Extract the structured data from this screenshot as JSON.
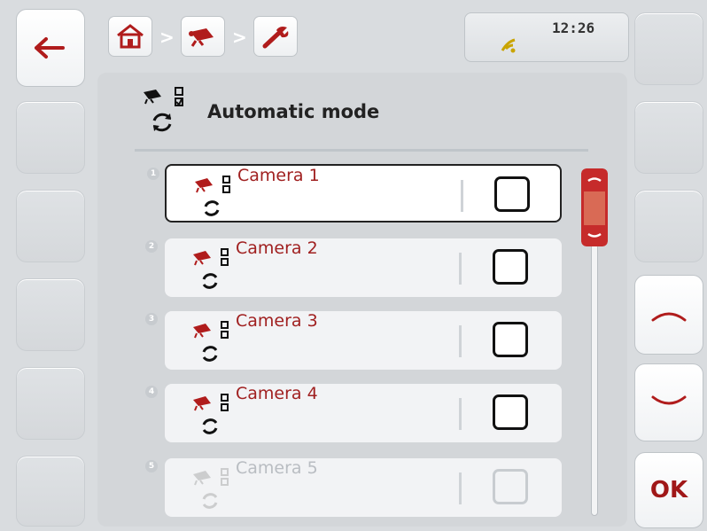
{
  "header": {
    "time": "12:26",
    "breadcrumb_icons": [
      "home-icon",
      "camera-icon",
      "wrench-icon"
    ],
    "breadcrumb_separator": ">",
    "status_icon": "connection-icon"
  },
  "page": {
    "title": "Automatic mode",
    "title_icon": "camera-auto-icon"
  },
  "list": {
    "items": [
      {
        "index": "1",
        "label": "Camera 1",
        "checked": false,
        "enabled": true,
        "selected": true
      },
      {
        "index": "2",
        "label": "Camera 2",
        "checked": false,
        "enabled": true,
        "selected": false
      },
      {
        "index": "3",
        "label": "Camera 3",
        "checked": false,
        "enabled": true,
        "selected": false
      },
      {
        "index": "4",
        "label": "Camera 4",
        "checked": false,
        "enabled": true,
        "selected": false
      },
      {
        "index": "5",
        "label": "Camera 5",
        "checked": false,
        "enabled": false,
        "selected": false
      }
    ]
  },
  "softkeys": {
    "back_icon": "arrow-left-icon",
    "up_icon": "chevron-up-icon",
    "down_icon": "chevron-down-icon",
    "ok_label": "OK"
  },
  "colors": {
    "accent": "#a02020",
    "background": "#d9dcdf"
  }
}
